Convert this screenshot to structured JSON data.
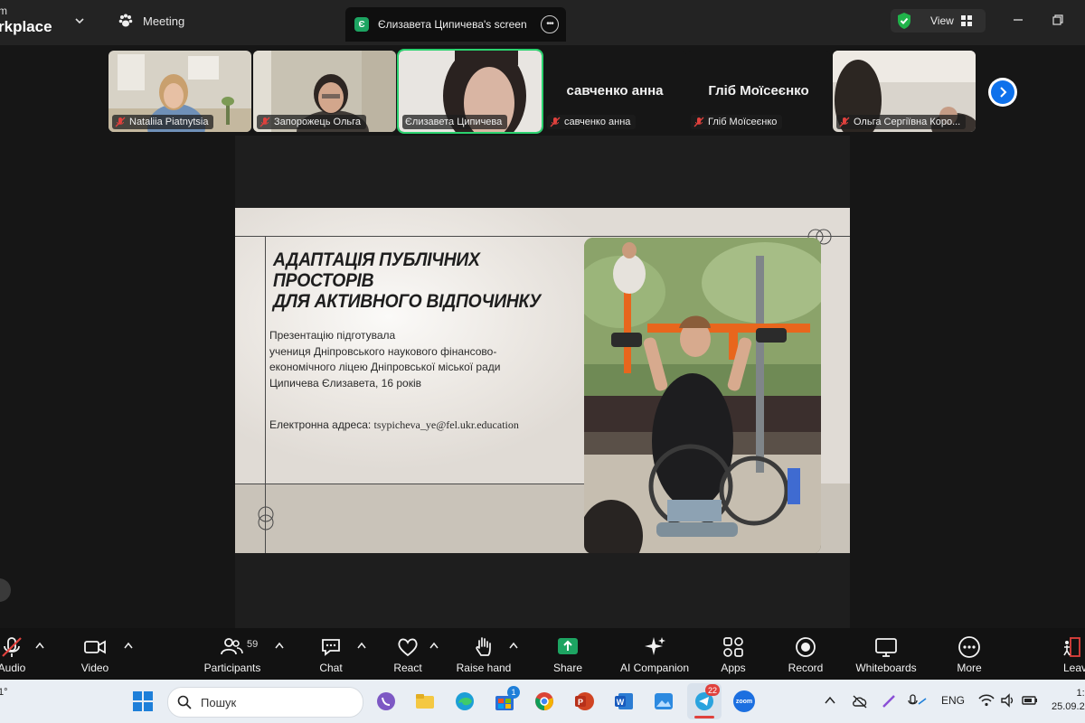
{
  "app": {
    "brand_line1": "m",
    "brand_line2": "rkplace",
    "meeting_label": "Meeting",
    "share_tab_badge": "Є",
    "share_tab_label": "Єлизавета Ципичева's screen",
    "view_label": "View"
  },
  "participants": [
    {
      "name": "Nataliia Piatnytsia",
      "muted": true
    },
    {
      "name": "Запорожець Ольга",
      "muted": true
    },
    {
      "name": "Єлизавета Ципичева",
      "muted": false,
      "active": true
    },
    {
      "name": "савченко анна",
      "muted": true,
      "display_name": "савченко анна"
    },
    {
      "name": "Гліб Моїсеєнко",
      "muted": true,
      "display_name": "Гліб Моїсеєнко"
    },
    {
      "name": "Ольга Сергіївна Коро...",
      "muted": true
    }
  ],
  "slide": {
    "title_line1": "АДАПТАЦІЯ ПУБЛІЧНИХ ПРОСТОРІВ",
    "title_line2": "ДЛЯ АКТИВНОГО ВІДПОЧИНКУ",
    "author_lines": [
      "Презентацію підготувала",
      "учениця Дніпровського наукового фінансово-",
      "економічного ліцею Дніпровської міської ради",
      "Ципичева Єлизавета, 16 років"
    ],
    "email_label": "Електронна адреса:",
    "email_value": "tsypicheva_ye@fel.ukr.education"
  },
  "toolbar": {
    "audio": "Audio",
    "video": "Video",
    "participants": "Participants",
    "participants_count": "59",
    "chat": "Chat",
    "react": "React",
    "raise_hand": "Raise hand",
    "share": "Share",
    "ai_companion": "AI Companion",
    "apps": "Apps",
    "record": "Record",
    "whiteboards": "Whiteboards",
    "more": "More",
    "leave": "Leav"
  },
  "taskbar": {
    "weather": "1°",
    "search_placeholder": "Пошук",
    "store_badge": "1",
    "telegram_badge": "22",
    "zoom_label": "zoom",
    "lang": "ENG",
    "time": "1:",
    "date": "25.09.2"
  },
  "colors": {
    "active_green": "#2bd26f",
    "zoom_blue": "#0e71eb",
    "share_green": "#1da462",
    "muted_red": "#e0413d"
  }
}
